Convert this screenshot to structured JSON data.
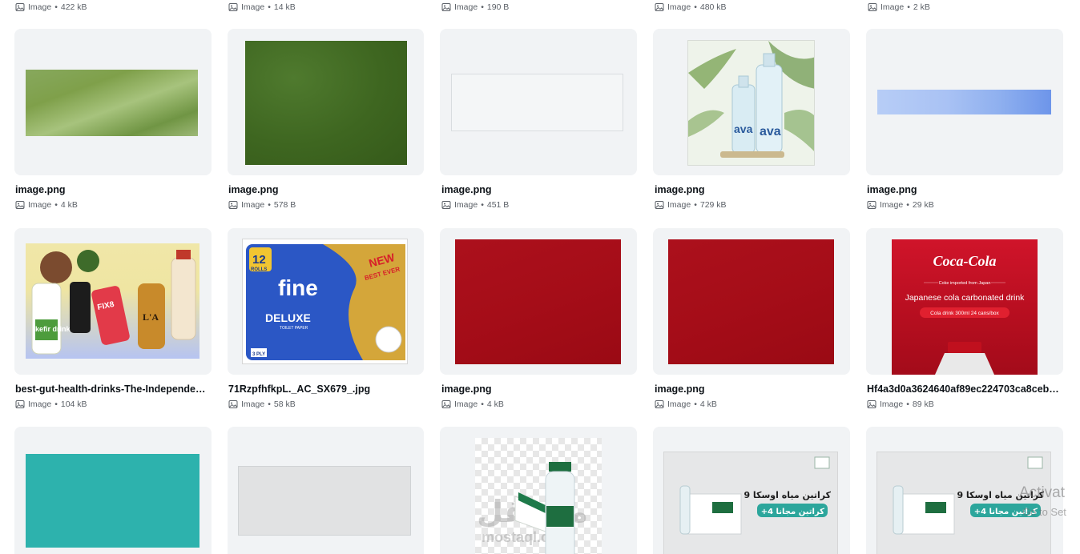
{
  "top_row_meta": [
    {
      "type": "Image",
      "size": "422 kB"
    },
    {
      "type": "Image",
      "size": "14 kB"
    },
    {
      "type": "Image",
      "size": "190 B"
    },
    {
      "type": "Image",
      "size": "480 kB"
    },
    {
      "type": "Image",
      "size": "2 kB"
    }
  ],
  "row1": [
    {
      "name": "image.png",
      "type": "Image",
      "size": "4 kB"
    },
    {
      "name": "image.png",
      "type": "Image",
      "size": "578 B"
    },
    {
      "name": "image.png",
      "type": "Image",
      "size": "451 B"
    },
    {
      "name": "image.png",
      "type": "Image",
      "size": "729 kB"
    },
    {
      "name": "image.png",
      "type": "Image",
      "size": "29 kB"
    }
  ],
  "row2": [
    {
      "name": "best-gut-health-drinks-The-Independent …",
      "type": "Image",
      "size": "104 kB"
    },
    {
      "name": "71RzpfhfkpL._AC_SX679_.jpg",
      "type": "Image",
      "size": "58 kB"
    },
    {
      "name": "image.png",
      "type": "Image",
      "size": "4 kB"
    },
    {
      "name": "image.png",
      "type": "Image",
      "size": "4 kB"
    },
    {
      "name": "Hf4a3d0a3624640af89ec224703ca8ceb…",
      "type": "Image",
      "size": "89 kB"
    }
  ],
  "thumbs": {
    "ava_brand": "ava",
    "fine": {
      "rolls": "12",
      "rolls_label": "ROLLS",
      "brand": "fine",
      "line": "DELUXE",
      "sub": "TOILET PAPER",
      "badge1": "NEW",
      "badge2": "BEST EVER",
      "ply": "3 PLY"
    },
    "coke": {
      "logo": "Coca-Cola",
      "small": "Coke imported from Japan",
      "headline": "Japanese cola carbonated drink",
      "pill": "Cola drink 300ml 24 cans/box"
    },
    "drinks": {
      "kefir": "kefir drink",
      "fix": "FIX8",
      "la": "L'A"
    },
    "oska": {
      "title": "9 كراتين مياه اوسكا",
      "offer": "+4 كراتين مجانا"
    },
    "mostaql": {
      "ar": "مستقل",
      "en": "mostaql.com"
    }
  },
  "watermark": {
    "line1": "Activat",
    "line2": "Go to Set"
  },
  "colors": {
    "accent_text": "#0e1318",
    "meta_text": "#5b6067",
    "card_bg": "#f1f3f5"
  }
}
